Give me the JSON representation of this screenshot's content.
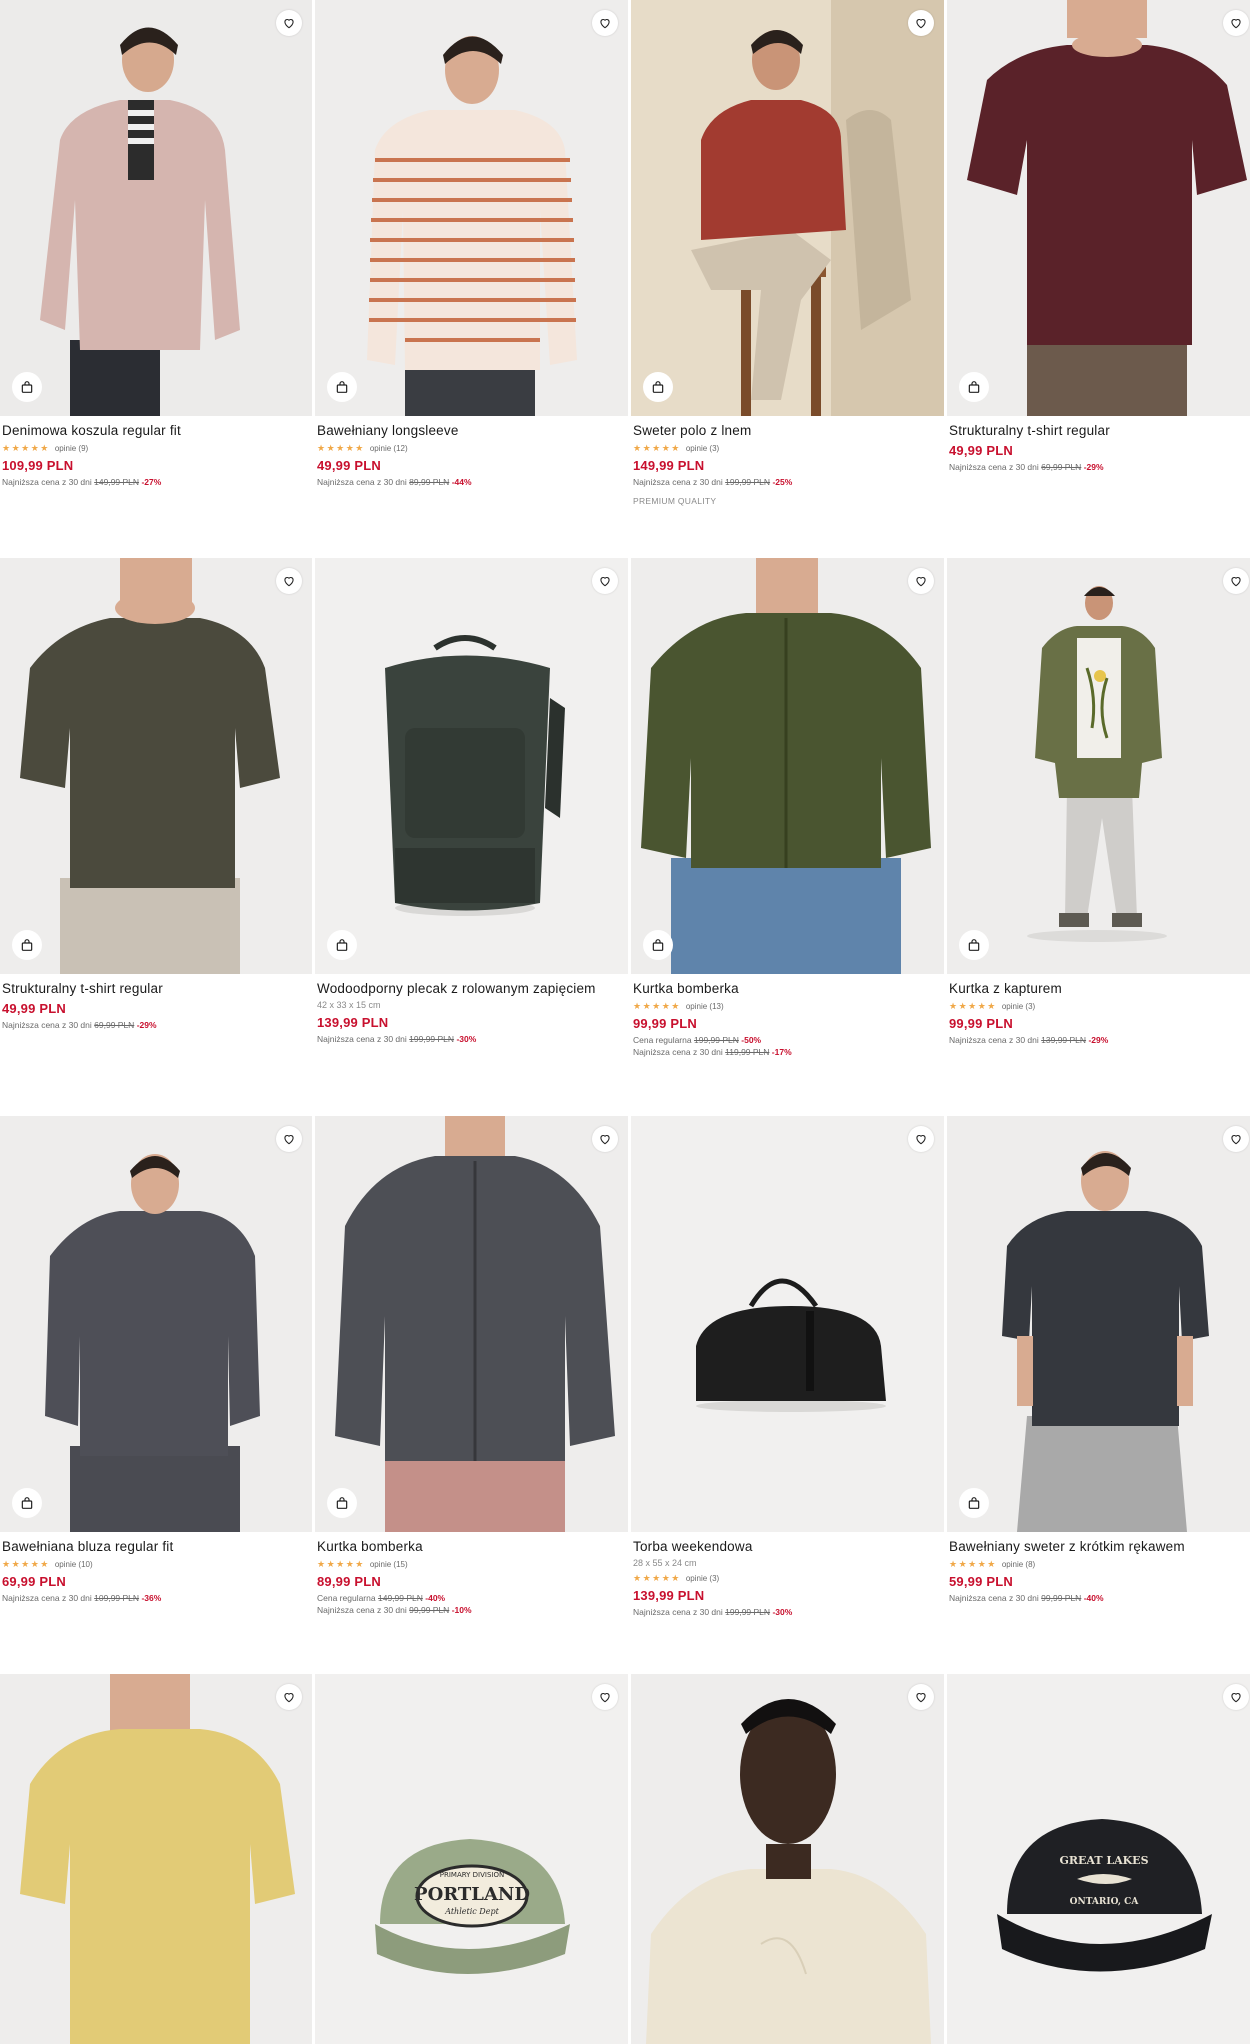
{
  "icons": {
    "wishlist": "heart-outline-icon",
    "add_to_bag": "shopping-bag-icon"
  },
  "colors": {
    "price": "#c8102e",
    "stars": "#f0a848"
  },
  "products": [
    {
      "title": "Denimowa koszula regular fit",
      "stars": "★★★★★",
      "reviews": "opinie (9)",
      "price": "109,99 PLN",
      "lowest_label": "Najniższa cena z 30 dni",
      "lowest_old": "149,99 PLN",
      "lowest_disc": "-27%"
    },
    {
      "title": "Bawełniany longsleeve",
      "stars": "★★★★★",
      "reviews": "opinie (12)",
      "price": "49,99 PLN",
      "lowest_label": "Najniższa cena z 30 dni",
      "lowest_old": "89,99 PLN",
      "lowest_disc": "-44%"
    },
    {
      "title": "Sweter polo z lnem",
      "stars": "★★★★★",
      "reviews": "opinie (3)",
      "price": "149,99 PLN",
      "lowest_label": "Najniższa cena z 30 dni",
      "lowest_old": "199,99 PLN",
      "lowest_disc": "-25%",
      "tag": "PREMIUM QUALITY"
    },
    {
      "title": "Strukturalny t-shirt regular",
      "price": "49,99 PLN",
      "lowest_label": "Najniższa cena z 30 dni",
      "lowest_old": "69,99 PLN",
      "lowest_disc": "-29%"
    },
    {
      "title": "Strukturalny t-shirt regular",
      "price": "49,99 PLN",
      "lowest_label": "Najniższa cena z 30 dni",
      "lowest_old": "69,99 PLN",
      "lowest_disc": "-29%"
    },
    {
      "title": "Wodoodporny plecak z rolowanym zapięciem",
      "subtitle": "42 x 33 x 15 cm",
      "price": "139,99 PLN",
      "lowest_label": "Najniższa cena z 30 dni",
      "lowest_old": "199,99 PLN",
      "lowest_disc": "-30%"
    },
    {
      "title": "Kurtka bomberka",
      "stars": "★★★★★",
      "reviews": "opinie (13)",
      "price": "99,99 PLN",
      "regular_label": "Cena regularna",
      "regular_old": "199,99 PLN",
      "regular_disc": "-50%",
      "lowest_label": "Najniższa cena z 30 dni",
      "lowest_old": "119,99 PLN",
      "lowest_disc": "-17%"
    },
    {
      "title": "Kurtka z kapturem",
      "stars": "★★★★★",
      "reviews": "opinie (3)",
      "price": "99,99 PLN",
      "lowest_label": "Najniższa cena z 30 dni",
      "lowest_old": "139,99 PLN",
      "lowest_disc": "-29%"
    },
    {
      "title": "Bawełniana bluza regular fit",
      "stars": "★★★★★",
      "reviews": "opinie (10)",
      "price": "69,99 PLN",
      "lowest_label": "Najniższa cena z 30 dni",
      "lowest_old": "109,99 PLN",
      "lowest_disc": "-36%"
    },
    {
      "title": "Kurtka bomberka",
      "stars": "★★★★★",
      "reviews": "opinie (15)",
      "price": "89,99 PLN",
      "regular_label": "Cena regularna",
      "regular_old": "149,99 PLN",
      "regular_disc": "-40%",
      "lowest_label": "Najniższa cena z 30 dni",
      "lowest_old": "99,99 PLN",
      "lowest_disc": "-10%"
    },
    {
      "title": "Torba weekendowa",
      "subtitle": "28 x 55 x 24 cm",
      "stars": "★★★★★",
      "reviews": "opinie (3)",
      "price": "139,99 PLN",
      "lowest_label": "Najniższa cena z 30 dni",
      "lowest_old": "199,99 PLN",
      "lowest_disc": "-30%"
    },
    {
      "title": "Bawełniany sweter z krótkim rękawem",
      "stars": "★★★★★",
      "reviews": "opinie (8)",
      "price": "59,99 PLN",
      "lowest_label": "Najniższa cena z 30 dni",
      "lowest_old": "99,99 PLN",
      "lowest_disc": "-40%"
    }
  ],
  "caps": [
    {
      "line1": "PRIMARY DIVISION",
      "line2": "PORTLAND",
      "line3": "Athletic Dept"
    },
    {
      "line1": "GREAT LAKES",
      "line3": "ONTARIO, CA"
    }
  ]
}
